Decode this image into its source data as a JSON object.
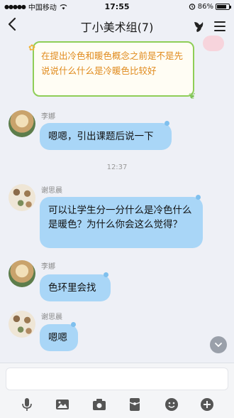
{
  "status": {
    "carrier": "中国移动",
    "time": "17:55",
    "battery": "86%",
    "battery_level": 0.86
  },
  "header": {
    "back_icon": "chevron-left-icon",
    "title": "丁小美术组(7)",
    "right_icons": [
      "group-members-icon",
      "menu-icon"
    ]
  },
  "notice": {
    "text": "在提出冷色和暖色概念之前是不是先说说什么什么是冷暖色比较好"
  },
  "messages": [
    {
      "sender": "李娜",
      "text": "嗯嗯，引出课题后说一下"
    },
    {
      "sender": "谢思晨",
      "text": "可以让学生分一分什么是冷色什么是暖色？为什么你会这么觉得？"
    },
    {
      "sender": "李娜",
      "text": "色环里会找"
    },
    {
      "sender": "谢思晨",
      "text": "嗯嗯"
    }
  ],
  "timestamp": "12:37",
  "input": {
    "placeholder": ""
  },
  "toolbar": [
    "microphone-icon",
    "image-icon",
    "camera-icon",
    "red-packet-icon",
    "emoji-icon",
    "plus-icon"
  ],
  "colors": {
    "bubble": "#a9d6f7",
    "notice_border": "#8fce57",
    "notice_text": "#e08a1c",
    "background": "#eef0f6"
  }
}
